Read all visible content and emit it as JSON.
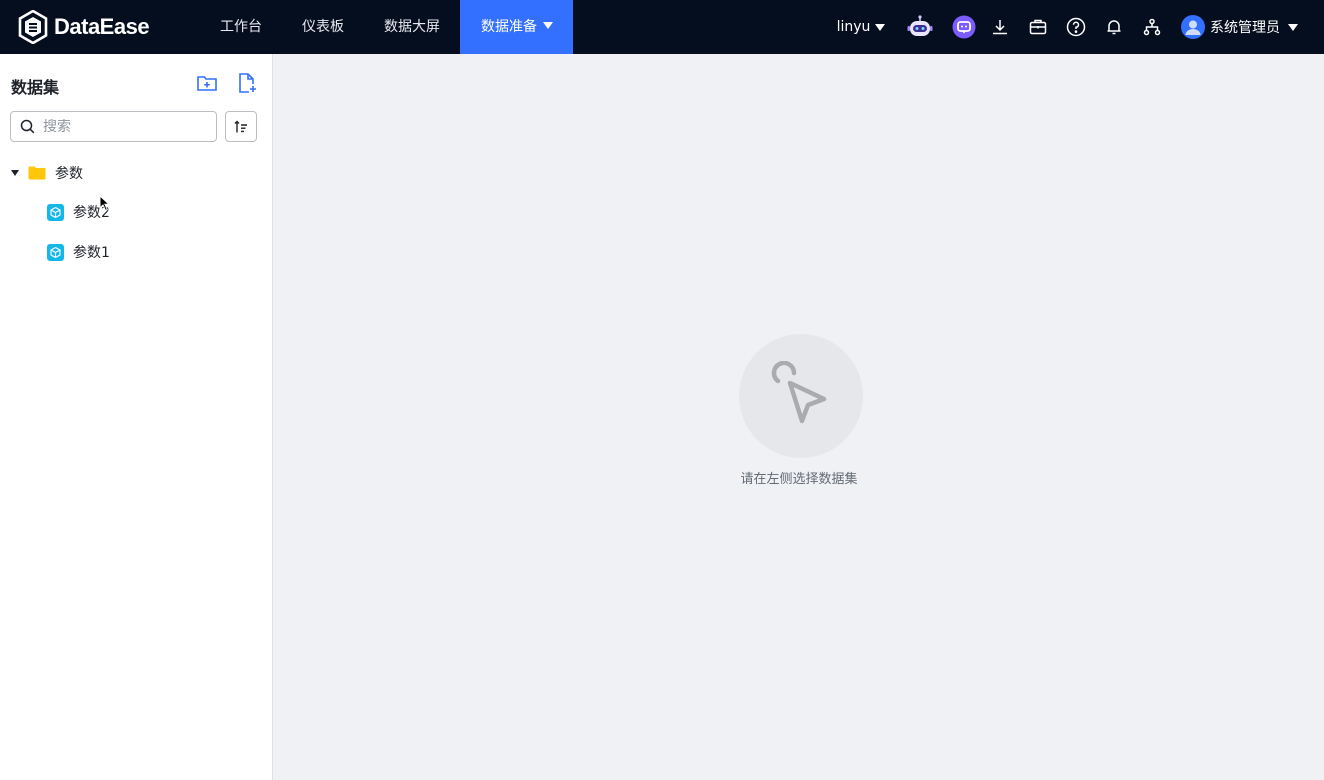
{
  "app": {
    "logo_text": "DataEase"
  },
  "nav": {
    "items": [
      {
        "label": "工作台"
      },
      {
        "label": "仪表板"
      },
      {
        "label": "数据大屏"
      },
      {
        "label": "数据准备"
      }
    ]
  },
  "header": {
    "org_name": "linyu",
    "user_name": "系统管理员"
  },
  "sidebar": {
    "title": "数据集",
    "search": {
      "placeholder": "搜索",
      "value": ""
    },
    "tree": {
      "folder": {
        "label": "参数"
      },
      "items": [
        {
          "label": "参数2"
        },
        {
          "label": "参数1"
        }
      ]
    }
  },
  "main": {
    "empty_text": "请在左侧选择数据集"
  },
  "colors": {
    "topbar": "#050e1f",
    "accent": "#3370ff",
    "folder": "#ffc60a",
    "dataset_icon": "#14b8e8"
  }
}
